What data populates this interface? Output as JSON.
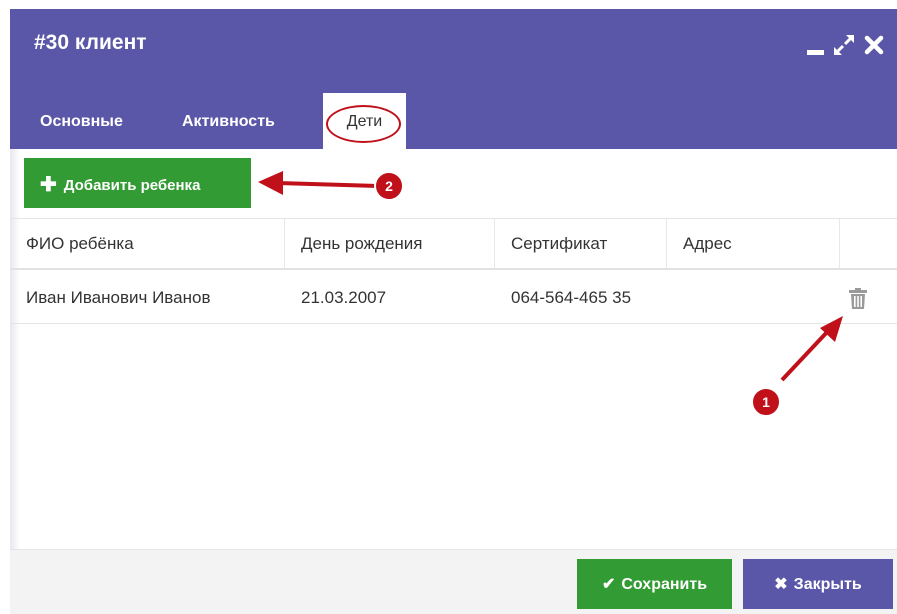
{
  "window": {
    "title": "#30 клиент",
    "controls": [
      "minimize-icon",
      "expand-icon",
      "close-icon"
    ]
  },
  "tabs": [
    {
      "label": "Основные",
      "active": false
    },
    {
      "label": "Активность",
      "active": false
    },
    {
      "label": "Дети",
      "active": true
    }
  ],
  "toolbar": {
    "add_child_label": "Добавить ребенка",
    "add_icon": "plus-icon"
  },
  "table": {
    "columns": [
      "ФИО ребёнка",
      "День рождения",
      "Сертификат",
      "Адрес"
    ],
    "rows": [
      {
        "name": "Иван Иванович Иванов",
        "birthday": "21.03.2007",
        "certificate": "064-564-465 35",
        "address": "",
        "action_icon": "trash-icon"
      }
    ]
  },
  "footer": {
    "save_label": "Сохранить",
    "close_label": "Закрыть"
  },
  "callouts": [
    {
      "number": "1"
    },
    {
      "number": "2"
    }
  ],
  "colors": {
    "header": "#5b57a8",
    "primary_green": "#339b33",
    "callout_red": "#c0101a"
  }
}
